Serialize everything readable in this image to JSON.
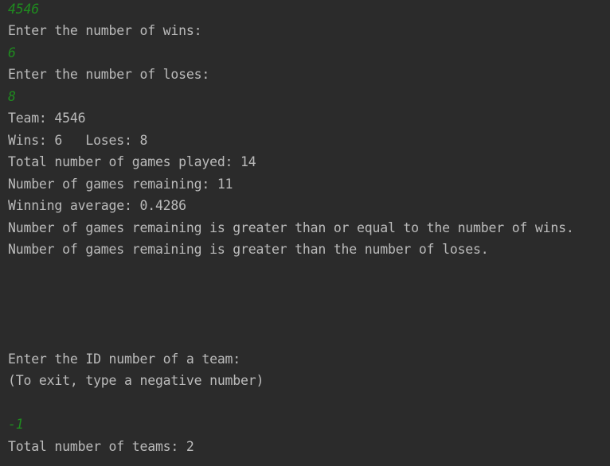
{
  "console": {
    "lines": [
      {
        "text": "4546",
        "kind": "input"
      },
      {
        "text": "Enter the number of wins:",
        "kind": "output"
      },
      {
        "text": "6",
        "kind": "input"
      },
      {
        "text": "Enter the number of loses:",
        "kind": "output"
      },
      {
        "text": "8",
        "kind": "input"
      },
      {
        "text": "Team: 4546",
        "kind": "output"
      },
      {
        "text": "Wins: 6   Loses: 8",
        "kind": "output"
      },
      {
        "text": "Total number of games played: 14",
        "kind": "output"
      },
      {
        "text": "Number of games remaining: 11",
        "kind": "output"
      },
      {
        "text": "Winning average: 0.4286",
        "kind": "output"
      },
      {
        "text": "Number of games remaining is greater than or equal to the number of wins.",
        "kind": "output"
      },
      {
        "text": "Number of games remaining is greater than the number of loses.",
        "kind": "output"
      },
      {
        "text": "",
        "kind": "output"
      },
      {
        "text": "",
        "kind": "output"
      },
      {
        "text": "",
        "kind": "output"
      },
      {
        "text": "",
        "kind": "output"
      },
      {
        "text": "Enter the ID number of a team:",
        "kind": "output"
      },
      {
        "text": "(To exit, type a negative number)",
        "kind": "output"
      },
      {
        "text": "",
        "kind": "output"
      },
      {
        "text": "-1",
        "kind": "input"
      },
      {
        "text": "Total number of teams: 2",
        "kind": "output"
      }
    ]
  },
  "colors": {
    "background": "#2b2b2b",
    "output_text": "#bbbbbb",
    "input_text": "#1f8c1f"
  }
}
